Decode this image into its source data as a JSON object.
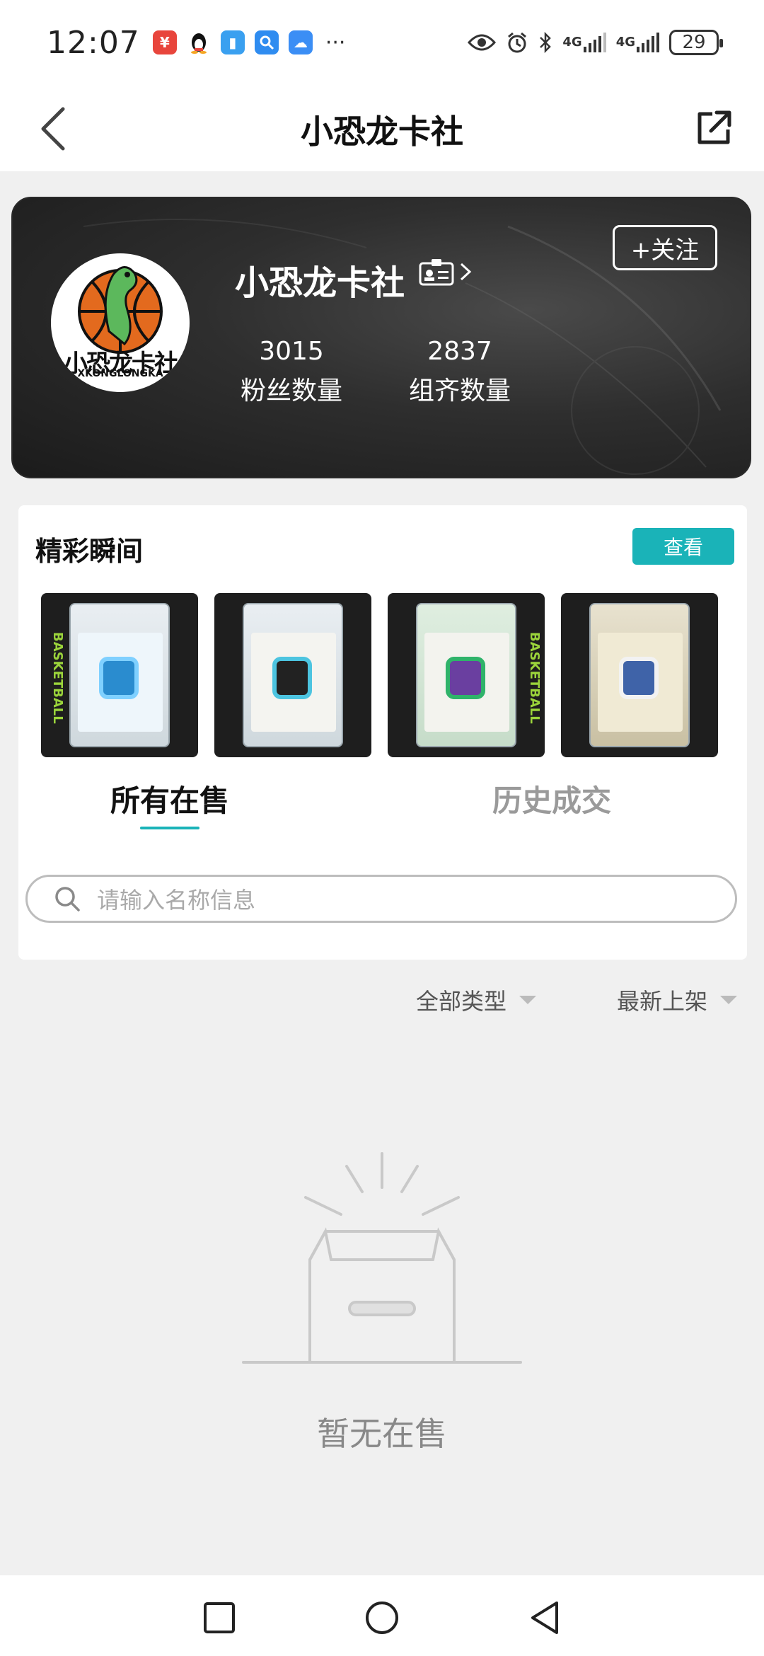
{
  "status_bar": {
    "time": "12:07",
    "network_1": "4G",
    "network_2": "4G",
    "battery": "29",
    "more": "···"
  },
  "header": {
    "title": "小恐龙卡社"
  },
  "profile": {
    "name": "小恐龙卡社",
    "follow_label": "+关注",
    "avatar_text": "小恐龙卡社",
    "avatar_subtext": "XKONGLONGKA",
    "fans": {
      "value": "3015",
      "label": "粉丝数量"
    },
    "sets": {
      "value": "2837",
      "label": "组齐数量"
    }
  },
  "highlights": {
    "title": "精彩瞬间",
    "view_label": "查看",
    "thumb_side_text": "BASKETBALL"
  },
  "tabs": [
    {
      "label": "所有在售",
      "active": true
    },
    {
      "label": "历史成交",
      "active": false
    }
  ],
  "search": {
    "placeholder": "请输入名称信息"
  },
  "filters": {
    "type_label": "全部类型",
    "sort_label": "最新上架"
  },
  "empty_state": {
    "text": "暂无在售"
  },
  "colors": {
    "accent": "#1ab3b8",
    "card_dark": "#2e2e2e"
  }
}
